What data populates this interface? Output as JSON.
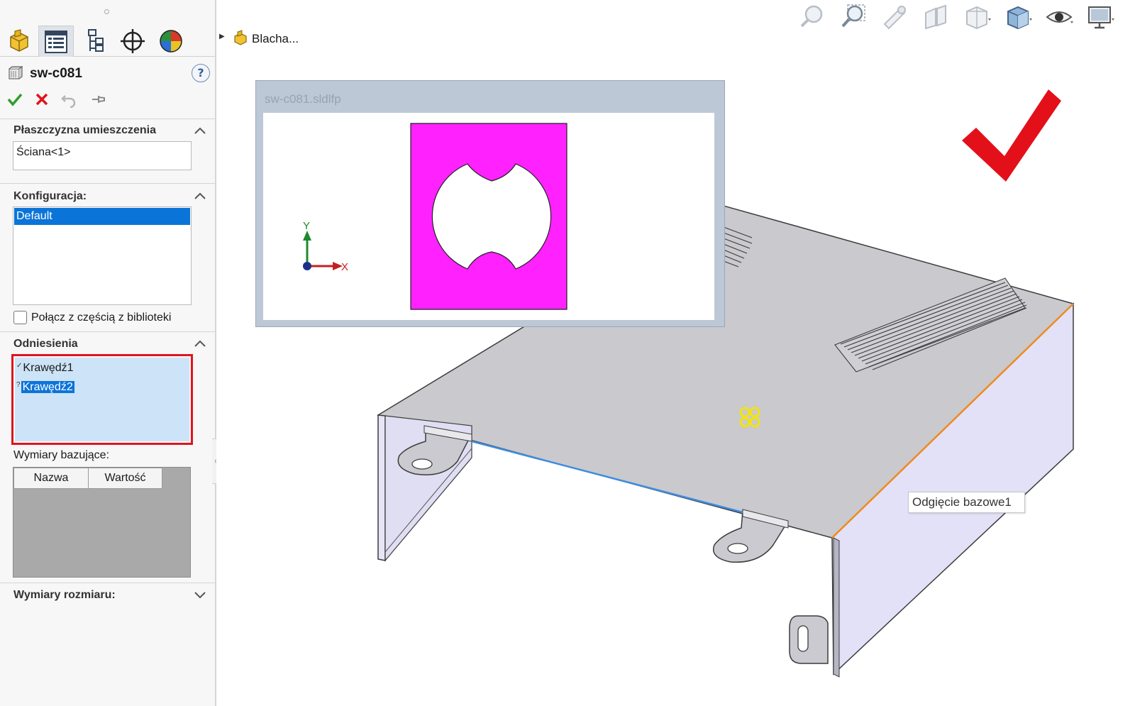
{
  "property_manager": {
    "title": "sw-c081",
    "help_label": "?",
    "sections": {
      "placement": {
        "title": "Płaszczyzna umieszczenia",
        "value": "Ściana<1>"
      },
      "configuration": {
        "title": "Konfiguracja:",
        "items": [
          "Default"
        ]
      },
      "library_link": {
        "label": "Połącz z częścią z biblioteki",
        "checked": false
      },
      "references": {
        "title": "Odniesienia",
        "items": [
          {
            "mark": "✓",
            "label": "Krawędź1",
            "selected": false
          },
          {
            "mark": "?",
            "label": "Krawędź2",
            "selected": true
          }
        ]
      },
      "locating_dims": {
        "title": "Wymiary bazujące:",
        "columns": [
          "Nazwa",
          "Wartość"
        ]
      },
      "size_dims": {
        "title": "Wymiary rozmiaru:"
      }
    }
  },
  "feature_tree": {
    "root_label": "Blacha..."
  },
  "preview": {
    "title": "sw-c081.sldlfp",
    "axis_x": "X",
    "axis_y": "Y",
    "profile_color": "#ff22ff"
  },
  "tooltip": {
    "text": "Odgięcie bazowe1"
  },
  "colors": {
    "accept_green": "#2e9e2e",
    "cancel_red": "#e0141e",
    "highlight_box": "#e0141e",
    "selection_blue": "#0b74d8",
    "edge_orange": "#f08a1c",
    "edge_blue": "#3c8de0"
  },
  "icons": {
    "tabs": [
      "feature-manager-icon",
      "property-manager-icon",
      "configuration-manager-icon",
      "dimxpert-icon",
      "display-manager-icon"
    ],
    "hud": [
      "zoom-to-fit-icon",
      "zoom-to-area-icon",
      "previous-view-icon",
      "section-view-icon",
      "view-orientation-icon",
      "display-style-icon",
      "hide-show-icon",
      "view-settings-icon"
    ]
  }
}
